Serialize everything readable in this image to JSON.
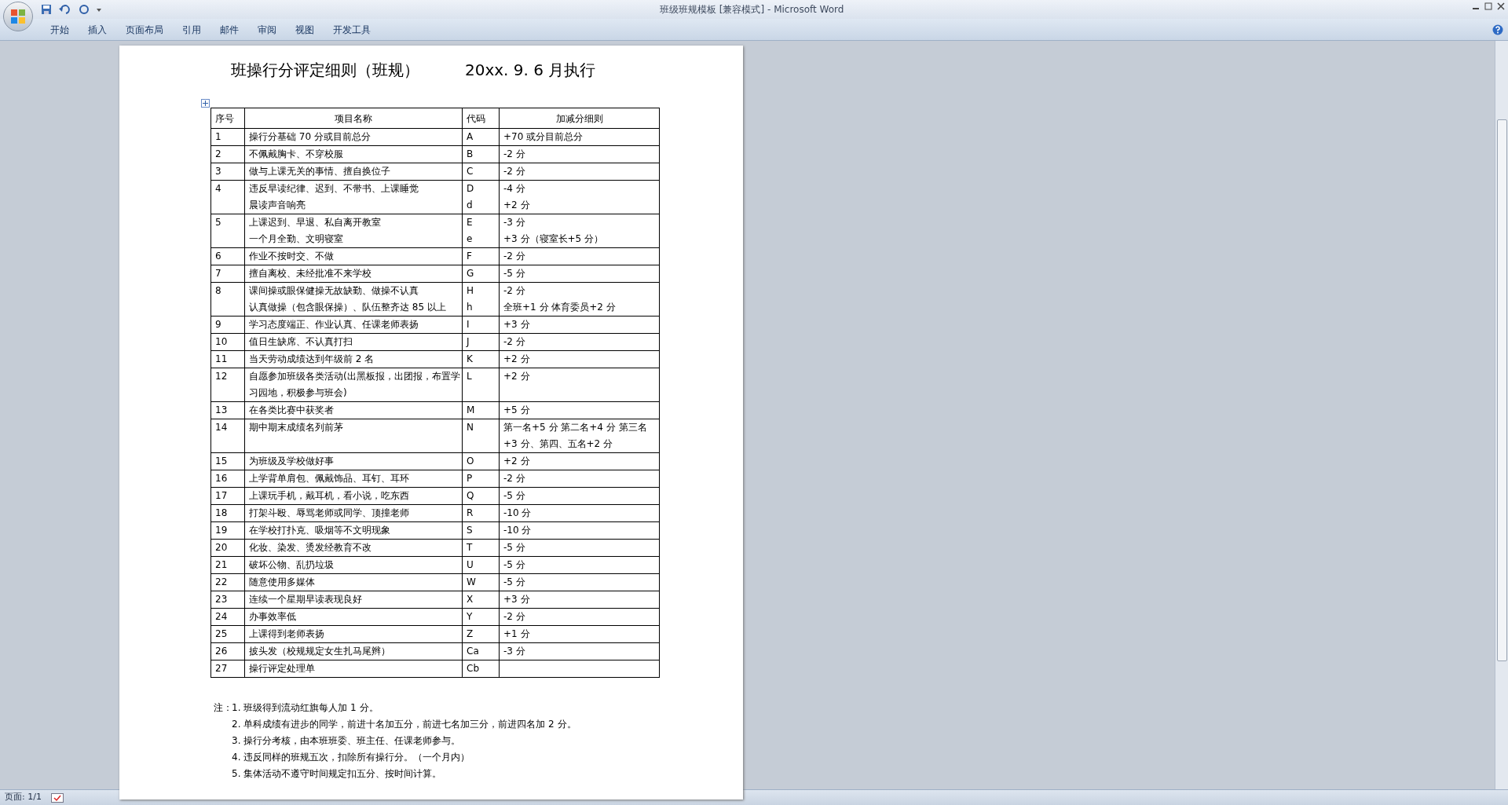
{
  "window": {
    "title": "班级班规模板 [兼容模式] - Microsoft Word"
  },
  "ribbon_tabs": [
    "开始",
    "插入",
    "页面布局",
    "引用",
    "邮件",
    "审阅",
    "视图",
    "开发工具"
  ],
  "document": {
    "title": "班操行分评定细则（班规）",
    "date": "20xx. 9. 6 月执行",
    "table": {
      "columns": [
        "序号",
        "项目名称",
        "代码",
        "加减分细则"
      ],
      "rows": [
        {
          "no": "1",
          "names": [
            "操行分基础 70 分或目前总分"
          ],
          "codes": [
            "A"
          ],
          "scores": [
            "+70 或分目前总分"
          ]
        },
        {
          "no": "2",
          "names": [
            "不佩戴胸卡、不穿校服"
          ],
          "codes": [
            "B"
          ],
          "scores": [
            "-2 分"
          ]
        },
        {
          "no": "3",
          "names": [
            "做与上课无关的事情、擅自换位子"
          ],
          "codes": [
            "C"
          ],
          "scores": [
            "-2 分"
          ]
        },
        {
          "no": "4",
          "names": [
            "违反早读纪律、迟到、不带书、上课睡觉",
            "晨读声音响亮"
          ],
          "codes": [
            "D",
            "d"
          ],
          "scores": [
            "-4 分",
            "+2 分"
          ]
        },
        {
          "no": "5",
          "names": [
            "上课迟到、早退、私自离开教室",
            "一个月全勤、文明寝室"
          ],
          "codes": [
            "E",
            "e"
          ],
          "scores": [
            "-3 分",
            "+3 分（寝室长+5 分）"
          ]
        },
        {
          "no": "6",
          "names": [
            "作业不按时交、不做"
          ],
          "codes": [
            "F"
          ],
          "scores": [
            "-2 分"
          ]
        },
        {
          "no": "7",
          "names": [
            "擅自离校、未经批准不来学校"
          ],
          "codes": [
            "G"
          ],
          "scores": [
            "-5 分"
          ]
        },
        {
          "no": "8",
          "names": [
            "课间操或眼保健操无故缺勤、做操不认真",
            "认真做操（包含眼保操）、队伍整齐达 85 以上"
          ],
          "codes": [
            "H",
            "h"
          ],
          "scores": [
            "-2 分",
            "全班+1 分 体育委员+2 分"
          ]
        },
        {
          "no": "9",
          "names": [
            "学习态度端正、作业认真、任课老师表扬"
          ],
          "codes": [
            "I"
          ],
          "scores": [
            "+3 分"
          ]
        },
        {
          "no": "10",
          "names": [
            "值日生缺席、不认真打扫"
          ],
          "codes": [
            "J"
          ],
          "scores": [
            "-2 分"
          ]
        },
        {
          "no": "11",
          "names": [
            "当天劳动成绩达到年级前 2 名"
          ],
          "codes": [
            "K"
          ],
          "scores": [
            "+2 分"
          ]
        },
        {
          "no": "12",
          "names": [
            "自愿参加班级各类活动(出黑板报，出团报，布置学习园地，积极参与班会)"
          ],
          "codes": [
            "L"
          ],
          "scores": [
            "+2 分"
          ]
        },
        {
          "no": "13",
          "names": [
            "在各类比赛中获奖者"
          ],
          "codes": [
            "M"
          ],
          "scores": [
            "+5 分"
          ]
        },
        {
          "no": "14",
          "names": [
            "期中期末成绩名列前茅"
          ],
          "codes": [
            "N"
          ],
          "scores": [
            "第一名+5 分 第二名+4 分 第三名+3 分、第四、五名+2 分"
          ]
        },
        {
          "no": "15",
          "names": [
            "为班级及学校做好事"
          ],
          "codes": [
            "O"
          ],
          "scores": [
            "+2 分"
          ]
        },
        {
          "no": "16",
          "names": [
            "上学背单肩包、佩戴饰品、耳钉、耳环"
          ],
          "codes": [
            "P"
          ],
          "scores": [
            "-2 分"
          ]
        },
        {
          "no": "17",
          "names": [
            "上课玩手机，戴耳机，看小说，吃东西"
          ],
          "codes": [
            "Q"
          ],
          "scores": [
            "-5 分"
          ]
        },
        {
          "no": "18",
          "names": [
            "打架斗殴、辱骂老师或同学、顶撞老师"
          ],
          "codes": [
            "R"
          ],
          "scores": [
            "-10 分"
          ]
        },
        {
          "no": "19",
          "names": [
            "在学校打扑克、吸烟等不文明现象"
          ],
          "codes": [
            "S"
          ],
          "scores": [
            "-10 分"
          ]
        },
        {
          "no": "20",
          "names": [
            "化妆、染发、烫发经教育不改"
          ],
          "codes": [
            "T"
          ],
          "scores": [
            "-5 分"
          ]
        },
        {
          "no": "21",
          "names": [
            "破坏公物、乱扔垃圾"
          ],
          "codes": [
            "U"
          ],
          "scores": [
            "-5 分"
          ]
        },
        {
          "no": "22",
          "names": [
            "随意使用多媒体"
          ],
          "codes": [
            "W"
          ],
          "scores": [
            "-5 分"
          ]
        },
        {
          "no": "23",
          "names": [
            "连续一个星期早读表现良好"
          ],
          "codes": [
            "X"
          ],
          "scores": [
            "+3 分"
          ]
        },
        {
          "no": "24",
          "names": [
            "办事效率低"
          ],
          "codes": [
            "Y"
          ],
          "scores": [
            "-2 分"
          ]
        },
        {
          "no": "25",
          "names": [
            "上课得到老师表扬"
          ],
          "codes": [
            "Z"
          ],
          "scores": [
            "+1 分"
          ]
        },
        {
          "no": "26",
          "names": [
            "披头发（校规规定女生扎马尾辫）"
          ],
          "codes": [
            "Ca"
          ],
          "scores": [
            "-3 分"
          ]
        },
        {
          "no": "27",
          "names": [
            "操行评定处理单"
          ],
          "codes": [
            "Cb"
          ]
        }
      ]
    },
    "notes_label": "注：",
    "notes": [
      "1. 班级得到流动红旗每人加 1 分。",
      "2. 单科成绩有进步的同学，前进十名加五分，前进七名加三分，前进四名加 2 分。",
      "3. 操行分考核，由本班班委、班主任、任课老师参与。",
      "4. 违反同样的班规五次，扣除所有操行分。（一个月内）",
      "5. 集体活动不遵守时间规定扣五分、按时间计算。"
    ]
  },
  "status_bar": {
    "page": "页面: 1/1"
  }
}
